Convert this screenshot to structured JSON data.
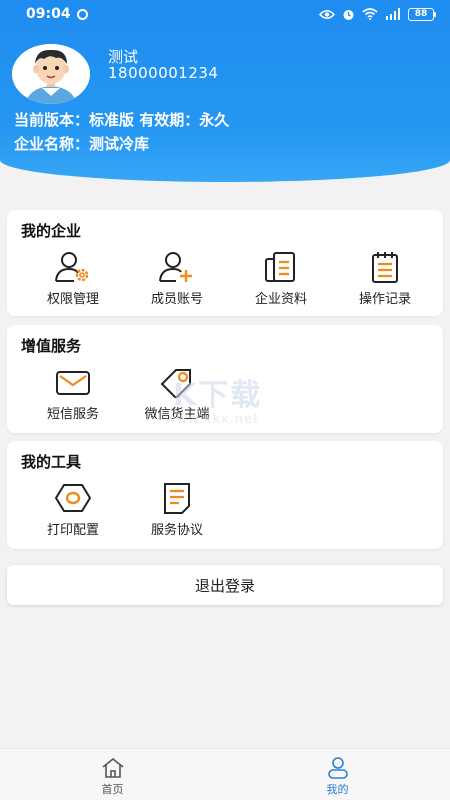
{
  "status_bar": {
    "time": "09:04",
    "battery": "88"
  },
  "profile": {
    "name": "测试",
    "phone": "18000001234",
    "version_line": "当前版本：标准版 有效期：永久",
    "company_line": "企业名称：测试冷库"
  },
  "sections": {
    "my_company": {
      "title": "我的企业",
      "items": [
        "权限管理",
        "成员账号",
        "企业资料",
        "操作记录"
      ]
    },
    "value_added": {
      "title": "增值服务",
      "items": [
        "短信服务",
        "微信货主端"
      ]
    },
    "my_tools": {
      "title": "我的工具",
      "items": [
        "打印配置",
        "服务协议"
      ]
    }
  },
  "logout_label": "退出登录",
  "watermark": {
    "text": "K下载",
    "url": "www.kkx.net"
  },
  "nav": {
    "home": "首页",
    "mine": "我的"
  },
  "colors": {
    "header": "#1e8cf0",
    "accent_orange": "#f08a1c",
    "active_nav": "#2a7fd6"
  }
}
